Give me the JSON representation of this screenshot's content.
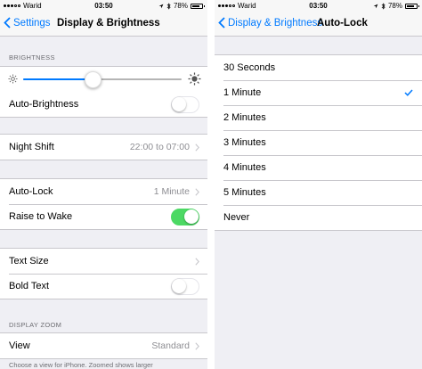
{
  "status_bar": {
    "carrier": "Warid",
    "time": "03:50",
    "battery": "78%",
    "battery_level": 0.78
  },
  "display_screen": {
    "back_label": "Settings",
    "title": "Display & Brightness",
    "brightness_header": "BRIGHTNESS",
    "brightness_level": 0.44,
    "auto_brightness": {
      "label": "Auto-Brightness",
      "on": false
    },
    "night_shift": {
      "label": "Night Shift",
      "value": "22:00 to 07:00"
    },
    "auto_lock": {
      "label": "Auto-Lock",
      "value": "1 Minute"
    },
    "raise_to_wake": {
      "label": "Raise to Wake",
      "on": true
    },
    "text_size": {
      "label": "Text Size"
    },
    "bold_text": {
      "label": "Bold Text",
      "on": false
    },
    "zoom_header": "DISPLAY ZOOM",
    "view": {
      "label": "View",
      "value": "Standard"
    },
    "footer": "Choose a view for iPhone. Zoomed shows larger"
  },
  "autolock_screen": {
    "back_label": "Display & Brightness",
    "title": "Auto-Lock",
    "options": [
      "30 Seconds",
      "1 Minute",
      "2 Minutes",
      "3 Minutes",
      "4 Minutes",
      "5 Minutes",
      "Never"
    ],
    "selected": "1 Minute"
  },
  "colors": {
    "accent": "#007aff",
    "switch_on": "#4cd964",
    "background": "#efeff4"
  },
  "icons": [
    "chevron-left-icon",
    "chevron-right-icon",
    "sun-icon",
    "checkmark-icon",
    "location-arrow-icon",
    "bluetooth-icon",
    "battery-icon",
    "signal-icon"
  ]
}
